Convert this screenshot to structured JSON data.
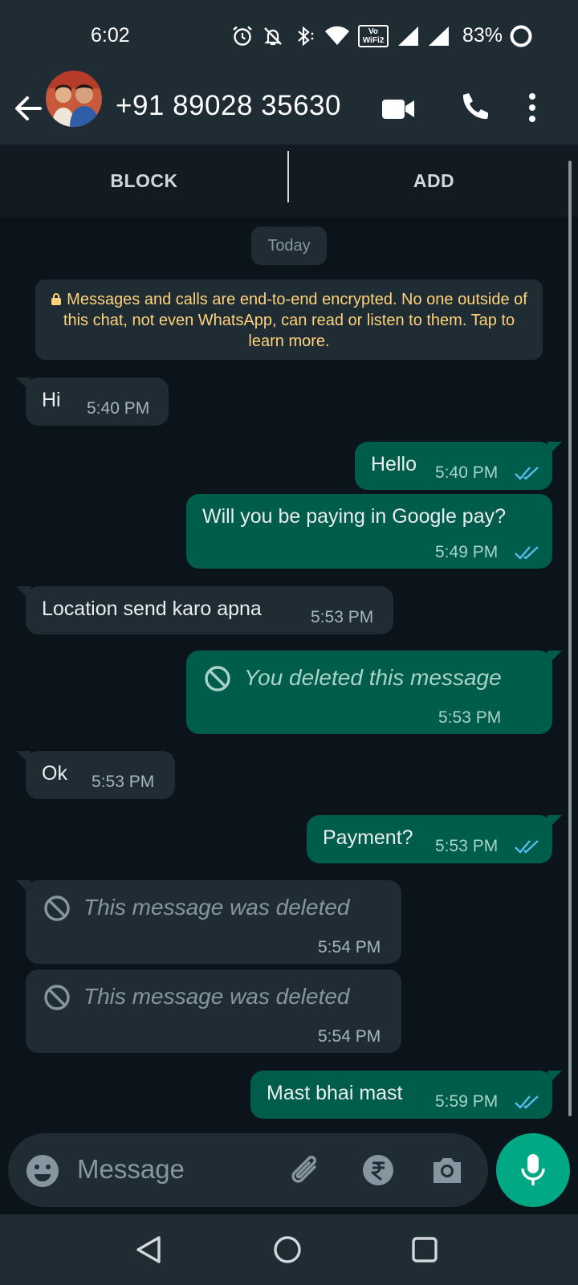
{
  "status_bar": {
    "time": "6:02",
    "battery": "83%",
    "icons": [
      "alarm-icon",
      "mute-icon",
      "bluetooth-icon",
      "wifi-icon",
      "vowifi-icon",
      "signal-icon",
      "signal-icon",
      "battery-ring-icon"
    ],
    "vowifi_top": "Vo",
    "vowifi_bottom": "WiFi2"
  },
  "header": {
    "title": "+91 89028 35630",
    "icons": [
      "back-arrow-icon",
      "video-call-icon",
      "phone-icon",
      "more-vert-icon"
    ]
  },
  "actions": {
    "block": "BLOCK",
    "add": "ADD"
  },
  "chat": {
    "date_chip": "Today",
    "encryption_notice": "Messages and calls are end-to-end encrypted. No one outside of this chat, not even WhatsApp, can read or listen to them. Tap to learn more.",
    "messages": [
      {
        "direction": "in",
        "text": "Hi",
        "time": "5:40 PM"
      },
      {
        "direction": "out",
        "text": "Hello",
        "time": "5:40 PM",
        "status": "read"
      },
      {
        "direction": "out",
        "text": "Will you be paying in Google pay?",
        "time": "5:49 PM",
        "status": "read"
      },
      {
        "direction": "in",
        "text": "Location send karo apna",
        "time": "5:53 PM"
      },
      {
        "direction": "out",
        "text": "You deleted this message",
        "time": "5:53 PM",
        "deleted": true
      },
      {
        "direction": "in",
        "text": "Ok",
        "time": "5:53 PM"
      },
      {
        "direction": "out",
        "text": "Payment?",
        "time": "5:53 PM",
        "status": "read"
      },
      {
        "direction": "in",
        "text": "This message was deleted",
        "time": "5:54 PM",
        "deleted": true
      },
      {
        "direction": "in",
        "text": "This message was deleted",
        "time": "5:54 PM",
        "deleted": true
      },
      {
        "direction": "out",
        "text": "Mast bhai mast",
        "time": "5:59 PM",
        "status": "read"
      }
    ]
  },
  "composer": {
    "placeholder": "Message",
    "icons": [
      "emoji-icon",
      "attach-icon",
      "rupee-payment-icon",
      "camera-icon",
      "mic-icon"
    ]
  },
  "colors": {
    "background": "#0b141a",
    "header": "#1f2c34",
    "incoming_bubble": "#1f2c34",
    "outgoing_bubble": "#005c4b",
    "accent": "#00a884",
    "read_ticks": "#53bdeb",
    "notice_text": "#ffd279"
  },
  "nav_bar": {
    "icons": [
      "nav-back-icon",
      "nav-home-icon",
      "nav-recents-icon"
    ]
  }
}
